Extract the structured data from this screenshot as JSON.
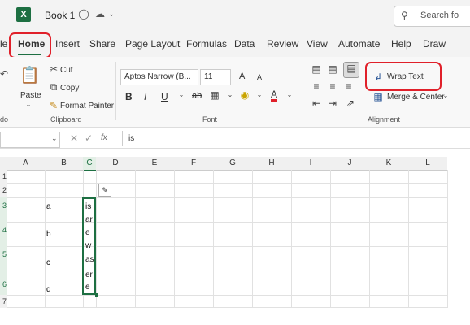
{
  "title_bar": {
    "app_logo": "X",
    "doc_title": "Book 1",
    "search_placeholder": "Search fo"
  },
  "menu": {
    "tabs": [
      "le",
      "Home",
      "Insert",
      "Share",
      "Page Layout",
      "Formulas",
      "Data",
      "Review",
      "View",
      "Automate",
      "Help",
      "Draw"
    ],
    "active": "Home"
  },
  "ribbon": {
    "clipboard": {
      "paste": "Paste",
      "cut": "Cut",
      "copy": "Copy",
      "format_painter": "Format Painter",
      "group_label": "Clipboard"
    },
    "font": {
      "font_name": "Aptos Narrow (B...",
      "font_size": "11",
      "group_label": "Font",
      "bold": "B",
      "italic": "I",
      "underline": "U",
      "strike": "ab",
      "font_color_letter": "A",
      "grow": "A",
      "shrink": "A"
    },
    "alignment": {
      "wrap_text": "Wrap Text",
      "merge_center": "Merge & Center",
      "group_label": "Alignment"
    },
    "left_group_label": "do"
  },
  "formula_bar": {
    "fx": "fx",
    "content": "is"
  },
  "grid": {
    "columns": [
      "A",
      "B",
      "C",
      "D",
      "E",
      "F",
      "G",
      "H",
      "I",
      "J",
      "K",
      "L"
    ],
    "rows": [
      "1",
      "2",
      "3",
      "4",
      "5",
      "6",
      "7"
    ],
    "cells_b": [
      "a",
      "b",
      "c",
      "d"
    ],
    "cells_c": [
      "is",
      "ar",
      "e",
      "w",
      "as",
      "er",
      "e"
    ]
  },
  "colors": {
    "accent": "#1d6f42",
    "highlight": "#e0202a"
  }
}
